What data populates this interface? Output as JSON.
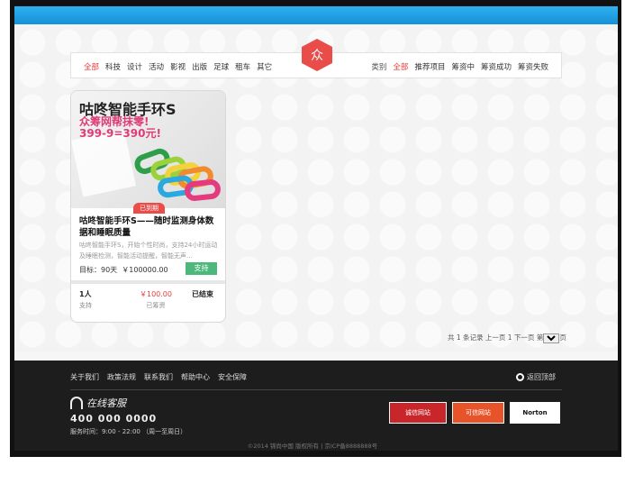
{
  "filter": {
    "categories": [
      "全部",
      "科技",
      "设计",
      "活动",
      "影视",
      "出版",
      "足球",
      "租车",
      "其它"
    ],
    "hex_char": "众",
    "right_label": "类别",
    "status_filters": [
      "全部",
      "推荐项目",
      "筹资中",
      "筹资成功",
      "筹资失败"
    ]
  },
  "card": {
    "poster": {
      "headline": "咕咚智能手环S",
      "sub1": "众筹网帮抹零!",
      "sub2": "399-9=390元!"
    },
    "badge": "已到期",
    "title": "咕咚智能手环S——随时监测身体数据和睡眠质量",
    "description": "咕咚智能手环S，开始个性时尚，支持24小时运动及睡眠检测，智能活动提醒，智能无声…",
    "goal_label": "目标：",
    "goal_days": "90天",
    "goal_amount": "￥100000.00",
    "support_label": "支持",
    "stats": [
      {
        "value": "1人",
        "label": "支持"
      },
      {
        "value": "￥100.00",
        "label": "已筹资"
      },
      {
        "value": "已结束",
        "label": ""
      }
    ]
  },
  "pager": {
    "text": "共 1 条记录 上一页 1 下一页 第",
    "page": "1",
    "suffix": "页"
  },
  "footer": {
    "links": [
      "关于我们",
      "政策法规",
      "联系我们",
      "帮助中心",
      "安全保障"
    ],
    "back_top": "返回顶部",
    "cs_title": "在线客服",
    "phone": "400 000 0000",
    "hours": "服务时间：9:00 - 22:00 （周一至周日）",
    "trust1": "诚信网站",
    "trust2": "可信网站",
    "trust3": "Norton",
    "copyright": "©2014 锦尚中国 版权所有 | 京ICP备8888888号"
  },
  "colors": {
    "accent": "#e94d4a",
    "blue": "#1ea0e6",
    "support": "#4cb97a"
  }
}
